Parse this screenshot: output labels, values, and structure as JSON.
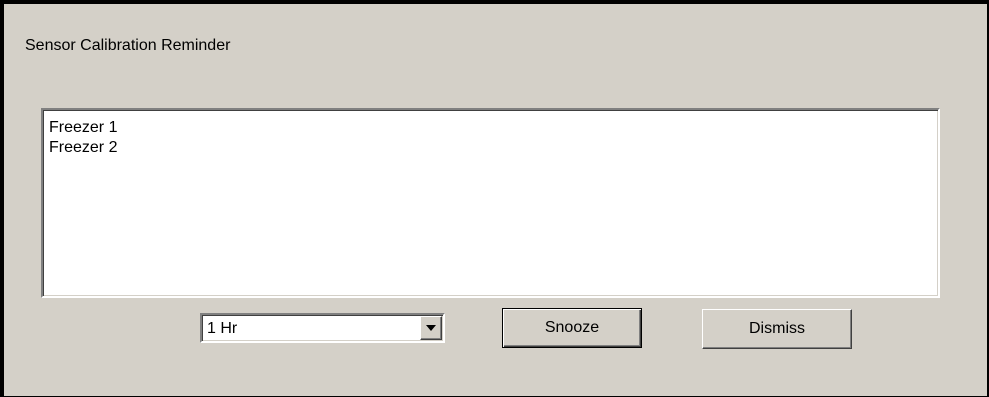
{
  "dialog": {
    "title": "Sensor Calibration Reminder",
    "sensors": [
      "Freezer 1",
      "Freezer 2"
    ],
    "snooze_interval": {
      "selected": "1 Hr",
      "icon": "chevron-down-icon"
    },
    "buttons": {
      "snooze_label": "Snooze",
      "dismiss_label": "Dismiss"
    }
  }
}
